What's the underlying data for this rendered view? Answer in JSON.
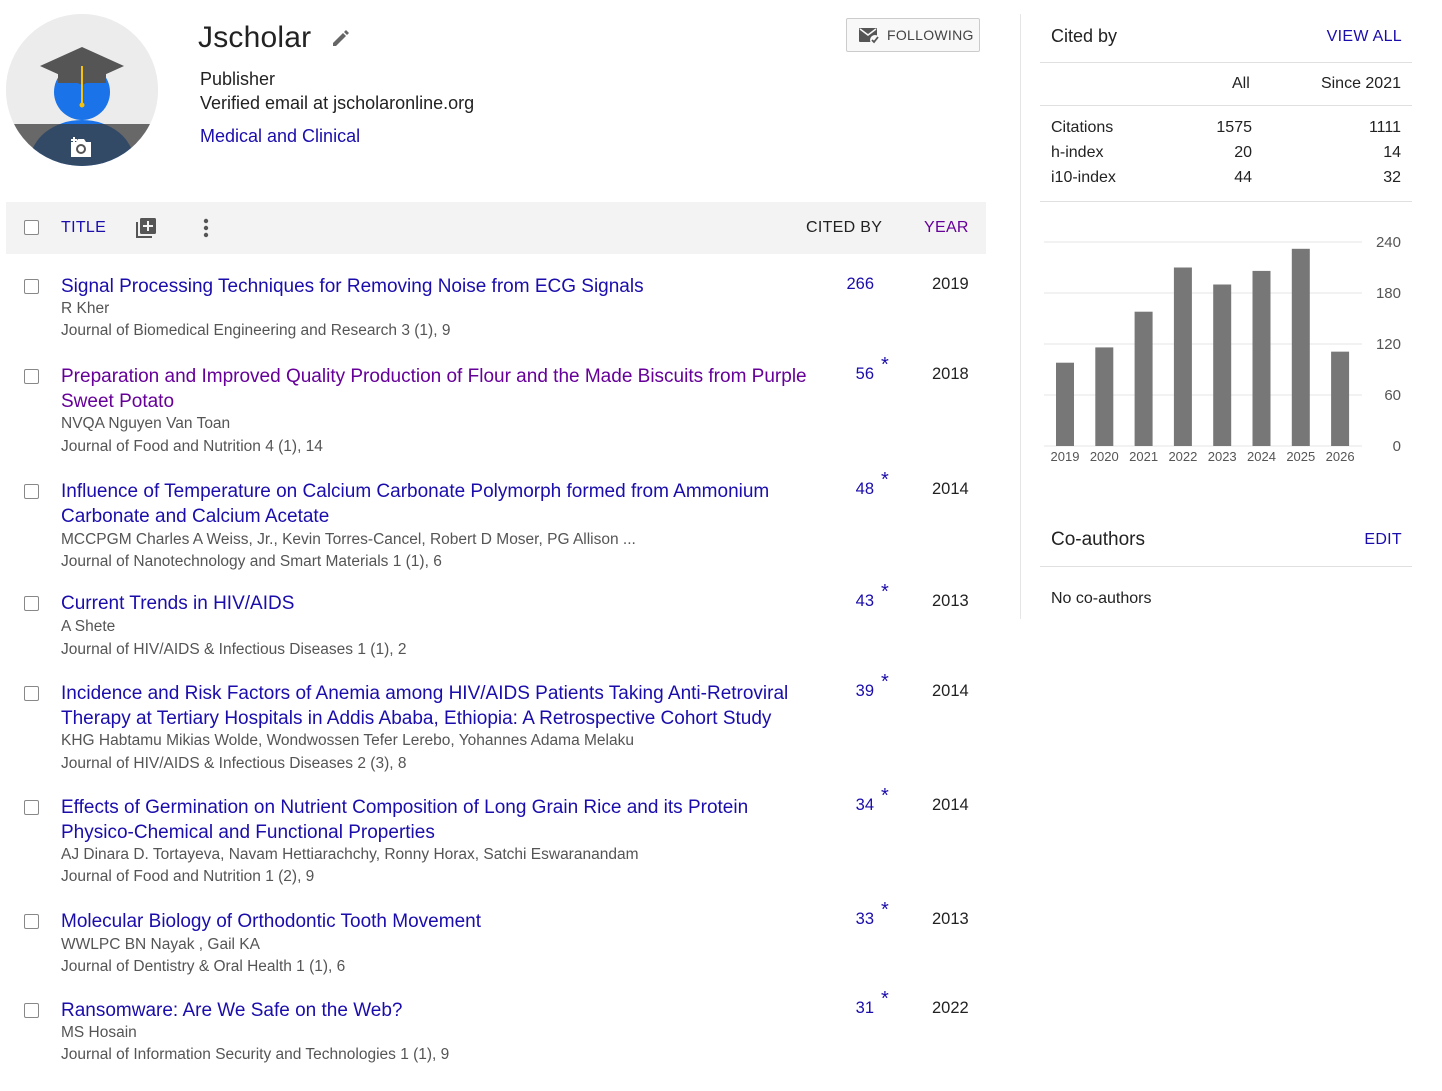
{
  "profile": {
    "name": "Jscholar",
    "affiliation": "Publisher",
    "email": "Verified email at jscholaronline.org",
    "interest": "Medical and Clinical",
    "follow_label": "FOLLOWING"
  },
  "table_header": {
    "title": "TITLE",
    "cited_by": "CITED BY",
    "year": "YEAR"
  },
  "articles": [
    {
      "title": "Signal Processing Techniques for Removing Noise from ECG Signals",
      "authors": "R Kher",
      "venue": "Journal of Biomedical Engineering and Research 3 (1), 9",
      "cited_by": "266",
      "star": "",
      "year": "2019",
      "visited": false
    },
    {
      "title": "Preparation and Improved Quality Production of Flour and the Made Biscuits from Purple Sweet Potato",
      "authors": "NVQA Nguyen Van Toan",
      "venue": "Journal of Food and Nutrition 4 (1), 14",
      "cited_by": "56",
      "star": "*",
      "year": "2018",
      "visited": true
    },
    {
      "title": "Influence of Temperature on Calcium Carbonate Polymorph formed from Ammonium Carbonate and Calcium Acetate",
      "authors": "MCCPGM Charles A Weiss, Jr., Kevin Torres-Cancel, Robert D Moser, PG Allison ...",
      "venue": "Journal of Nanotechnology and Smart Materials 1 (1), 6",
      "cited_by": "48",
      "star": "*",
      "year": "2014",
      "visited": false
    },
    {
      "title": "Current Trends in HIV/AIDS",
      "authors": "A Shete",
      "venue": "Journal of HIV/AIDS & Infectious Diseases 1 (1), 2",
      "cited_by": "43",
      "star": "*",
      "year": "2013",
      "visited": false
    },
    {
      "title": "Incidence and Risk Factors of Anemia among HIV/AIDS Patients Taking Anti-Retroviral Therapy at Tertiary Hospitals in Addis Ababa, Ethiopia: A Retrospective Cohort Study",
      "authors": "KHG Habtamu Mikias Wolde, Wondwossen Tefer Lerebo, Yohannes Adama Melaku",
      "venue": "Journal of HIV/AIDS & Infectious Diseases 2 (3), 8",
      "cited_by": "39",
      "star": "*",
      "year": "2014",
      "visited": false
    },
    {
      "title": "Effects of Germination on Nutrient Composition of Long Grain Rice and its Protein Physico-Chemical and Functional Properties",
      "authors": "AJ Dinara D. Tortayeva, Navam Hettiarachchy, Ronny Horax, Satchi Eswaranandam",
      "venue": "Journal of Food and Nutrition 1 (2), 9",
      "cited_by": "34",
      "star": "*",
      "year": "2014",
      "visited": false
    },
    {
      "title": "Molecular Biology of Orthodontic Tooth Movement",
      "authors": "WWLPC BN Nayak , Gail KA",
      "venue": "Journal of Dentistry & Oral Health 1 (1), 6",
      "cited_by": "33",
      "star": "*",
      "year": "2013",
      "visited": false
    },
    {
      "title": "Ransomware: Are We Safe on the Web?",
      "authors": "MS Hosain",
      "venue": "Journal of Information Security and Technologies 1 (1), 9",
      "cited_by": "31",
      "star": "*",
      "year": "2022",
      "visited": false
    }
  ],
  "cited_by": {
    "title": "Cited by",
    "view_all": "VIEW ALL",
    "col_all": "All",
    "col_since": "Since 2021",
    "stats": [
      {
        "label": "Citations",
        "all": "1575",
        "since": "1111"
      },
      {
        "label": "h-index",
        "all": "20",
        "since": "14"
      },
      {
        "label": "i10-index",
        "all": "44",
        "since": "32"
      }
    ]
  },
  "chart_data": {
    "type": "bar",
    "categories": [
      "2019",
      "2020",
      "2021",
      "2022",
      "2023",
      "2024",
      "2025",
      "2026"
    ],
    "values": [
      98,
      116,
      158,
      210,
      190,
      206,
      232,
      111
    ],
    "ylim": [
      0,
      240
    ],
    "yticks": [
      "0",
      "60",
      "120",
      "180",
      "240"
    ],
    "bar_color": "#777777",
    "grid": true,
    "y_axis_side": "right"
  },
  "coauthors": {
    "title": "Co-authors",
    "edit": "EDIT",
    "empty": "No co-authors"
  },
  "colors": {
    "link": "#1a0dab",
    "visited": "#660099",
    "header_bg": "#f3f3f3"
  }
}
